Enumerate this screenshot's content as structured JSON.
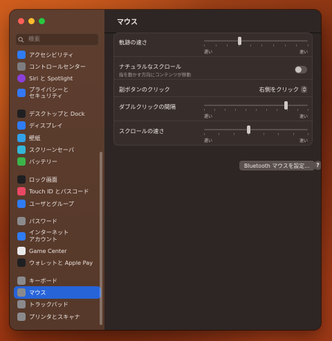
{
  "search": {
    "placeholder": "検索"
  },
  "sidebar": {
    "items": [
      {
        "label": "アクセシビリティ",
        "icon": "accessibility-icon",
        "color": "#2f7cf6",
        "round": false
      },
      {
        "label": "コントロールセンター",
        "icon": "control-center-icon",
        "color": "#7d7d80",
        "round": false
      },
      {
        "label": "Siri と Spotlight",
        "icon": "siri-icon",
        "color": "#8b3fd9",
        "round": true
      },
      {
        "label": "プライバシーと\nセキュリティ",
        "icon": "privacy-hand-icon",
        "color": "#3478f6",
        "round": false,
        "tall": true
      },
      {
        "gap": true
      },
      {
        "label": "デスクトップと Dock",
        "icon": "desktop-dock-icon",
        "color": "#1f1f22",
        "round": false
      },
      {
        "label": "ディスプレイ",
        "icon": "display-icon",
        "color": "#2f7cf6",
        "round": false
      },
      {
        "label": "壁紙",
        "icon": "wallpaper-icon",
        "color": "#32a0e8",
        "round": false
      },
      {
        "label": "スクリーンセーバ",
        "icon": "screensaver-icon",
        "color": "#35b6d8",
        "round": false
      },
      {
        "label": "バッテリー",
        "icon": "battery-icon",
        "color": "#3cb44a",
        "round": false
      },
      {
        "gap": true
      },
      {
        "label": "ロック画面",
        "icon": "lock-screen-icon",
        "color": "#1f1f22",
        "round": false
      },
      {
        "label": "Touch ID とパスコード",
        "icon": "fingerprint-icon",
        "color": "#e94865",
        "round": false
      },
      {
        "label": "ユーザとグループ",
        "icon": "users-icon",
        "color": "#2f7cf6",
        "round": false
      },
      {
        "gap": true
      },
      {
        "label": "パスワード",
        "icon": "key-icon",
        "color": "#8a8a8d",
        "round": false
      },
      {
        "label": "インターネット\nアカウント",
        "icon": "at-sign-icon",
        "color": "#2f7cf6",
        "round": false,
        "tall": true
      },
      {
        "label": "Game Center",
        "icon": "game-center-icon",
        "color": "#e9e9ea",
        "round": false
      },
      {
        "label": "ウォレットと Apple Pay",
        "icon": "wallet-icon",
        "color": "#1f1f22",
        "round": false
      },
      {
        "gap": true
      },
      {
        "label": "キーボード",
        "icon": "keyboard-icon",
        "color": "#8a8a8d",
        "round": false
      },
      {
        "label": "マウス",
        "icon": "mouse-icon",
        "color": "#8a8a8d",
        "round": false,
        "selected": true
      },
      {
        "label": "トラックパッド",
        "icon": "trackpad-icon",
        "color": "#8a8a8d",
        "round": false
      },
      {
        "label": "プリンタとスキャナ",
        "icon": "printer-icon",
        "color": "#8a8a8d",
        "round": false
      }
    ]
  },
  "header": {
    "title": "マウス"
  },
  "settings": {
    "tracking_speed": {
      "label": "軌跡の速さ",
      "value": 0.34,
      "slow": "遅い",
      "fast": "速い",
      "ticks": 10
    },
    "natural_scroll": {
      "label": "ナチュラルなスクロール",
      "sublabel": "指を動かす方向にコンテンツが移動",
      "enabled": false
    },
    "secondary_click": {
      "label": "副ボタンのクリック",
      "value": "右側をクリック"
    },
    "double_click": {
      "label": "ダブルクリックの間隔",
      "value": 0.79,
      "slow": "遅い",
      "fast": "速い",
      "ticks": 11
    },
    "scroll_speed": {
      "label": "スクロールの速さ",
      "value": 0.43,
      "slow": "遅い",
      "fast": "速い",
      "ticks": 8
    }
  },
  "footer": {
    "bluetooth_button": "Bluetooth マウスを設定…",
    "help": "?"
  }
}
